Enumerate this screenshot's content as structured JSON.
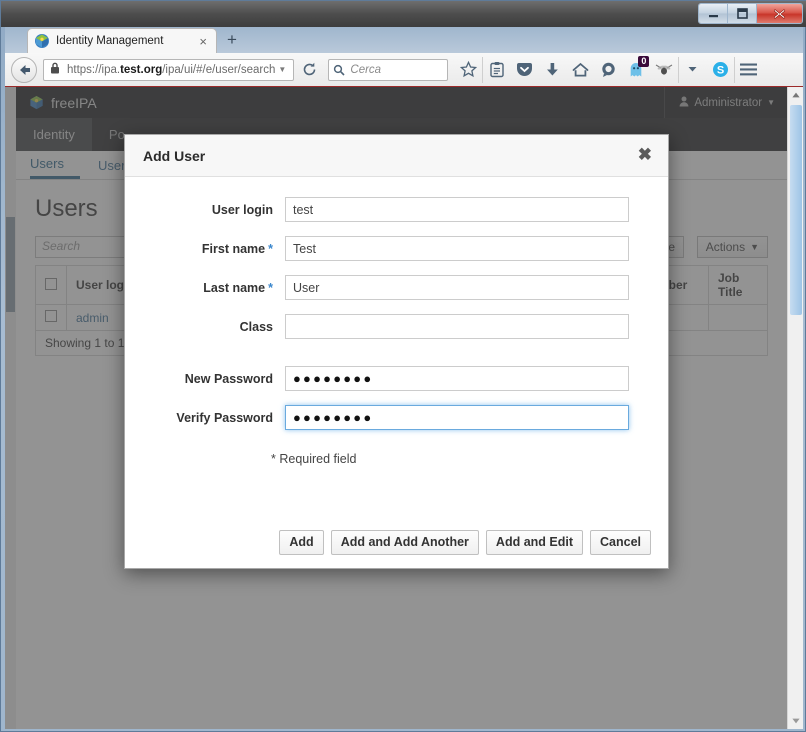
{
  "window": {
    "minimize_label": "Minimize",
    "maximize_label": "Maximize",
    "close_label": "Close"
  },
  "browser": {
    "tab": {
      "title": "Identity Management",
      "close_label": "×",
      "favicon": "freeipa-favicon-icon"
    },
    "new_tab_label": "+",
    "url": {
      "prefix": "https://ipa.",
      "domain": "test.org",
      "path": "/ipa/ui/#/e/user/search",
      "full": "https://ipa.test.org/ipa/ui/#/e/user/search"
    },
    "search": {
      "placeholder": "Cerca"
    },
    "toolbar_icons": [
      "bookmark-star-icon",
      "reading-list-icon",
      "pocket-icon",
      "downloads-icon",
      "home-icon",
      "chat-icon",
      "ghostery-icon",
      "flash-block-icon",
      "overflow-chevron-icon",
      "skype-icon",
      "menu-hamburger-icon"
    ],
    "ghostery_badge": "0"
  },
  "app": {
    "brand": "freeIPA",
    "user_menu": "Administrator",
    "tabs": [
      {
        "label": "Identity",
        "active": true
      },
      {
        "label": "Po",
        "active": false
      }
    ],
    "subtabs": [
      {
        "label": "Users",
        "active": true
      },
      {
        "label": "User",
        "active": false
      }
    ],
    "page_title": "Users",
    "search_placeholder": "Search",
    "buttons": {
      "enable": "Enable",
      "actions": "Actions"
    },
    "table": {
      "columns": [
        "",
        "User login",
        "mber",
        "Job Title"
      ],
      "rows": [
        {
          "login": "admin",
          "number": "",
          "job_title": ""
        }
      ],
      "footer": "Showing 1 to 1 of"
    }
  },
  "modal": {
    "title": "Add User",
    "close_label": "✖",
    "fields": [
      {
        "label": "User login",
        "value": "test",
        "required": false,
        "type": "text",
        "focused": false
      },
      {
        "label": "First name",
        "value": "Test",
        "required": true,
        "type": "text",
        "focused": false
      },
      {
        "label": "Last name",
        "value": "User",
        "required": true,
        "type": "text",
        "focused": false
      },
      {
        "label": "Class",
        "value": "",
        "required": false,
        "type": "text",
        "focused": false
      },
      {
        "label": "New Password",
        "value": "●●●●●●●●",
        "required": false,
        "type": "password",
        "focused": false
      },
      {
        "label": "Verify Password",
        "value": "●●●●●●●●",
        "required": false,
        "type": "password",
        "focused": true
      }
    ],
    "required_note": "* Required field",
    "required_marker": "*",
    "buttons": [
      "Add",
      "Add and Add Another",
      "Add and Edit",
      "Cancel"
    ]
  },
  "colors": {
    "accent_blue": "#2a688f",
    "required_star": "#3a87cd",
    "focus_ring": "#66afe9",
    "navbar_dark": "#1d1f21",
    "close_red": "#c8352a"
  }
}
